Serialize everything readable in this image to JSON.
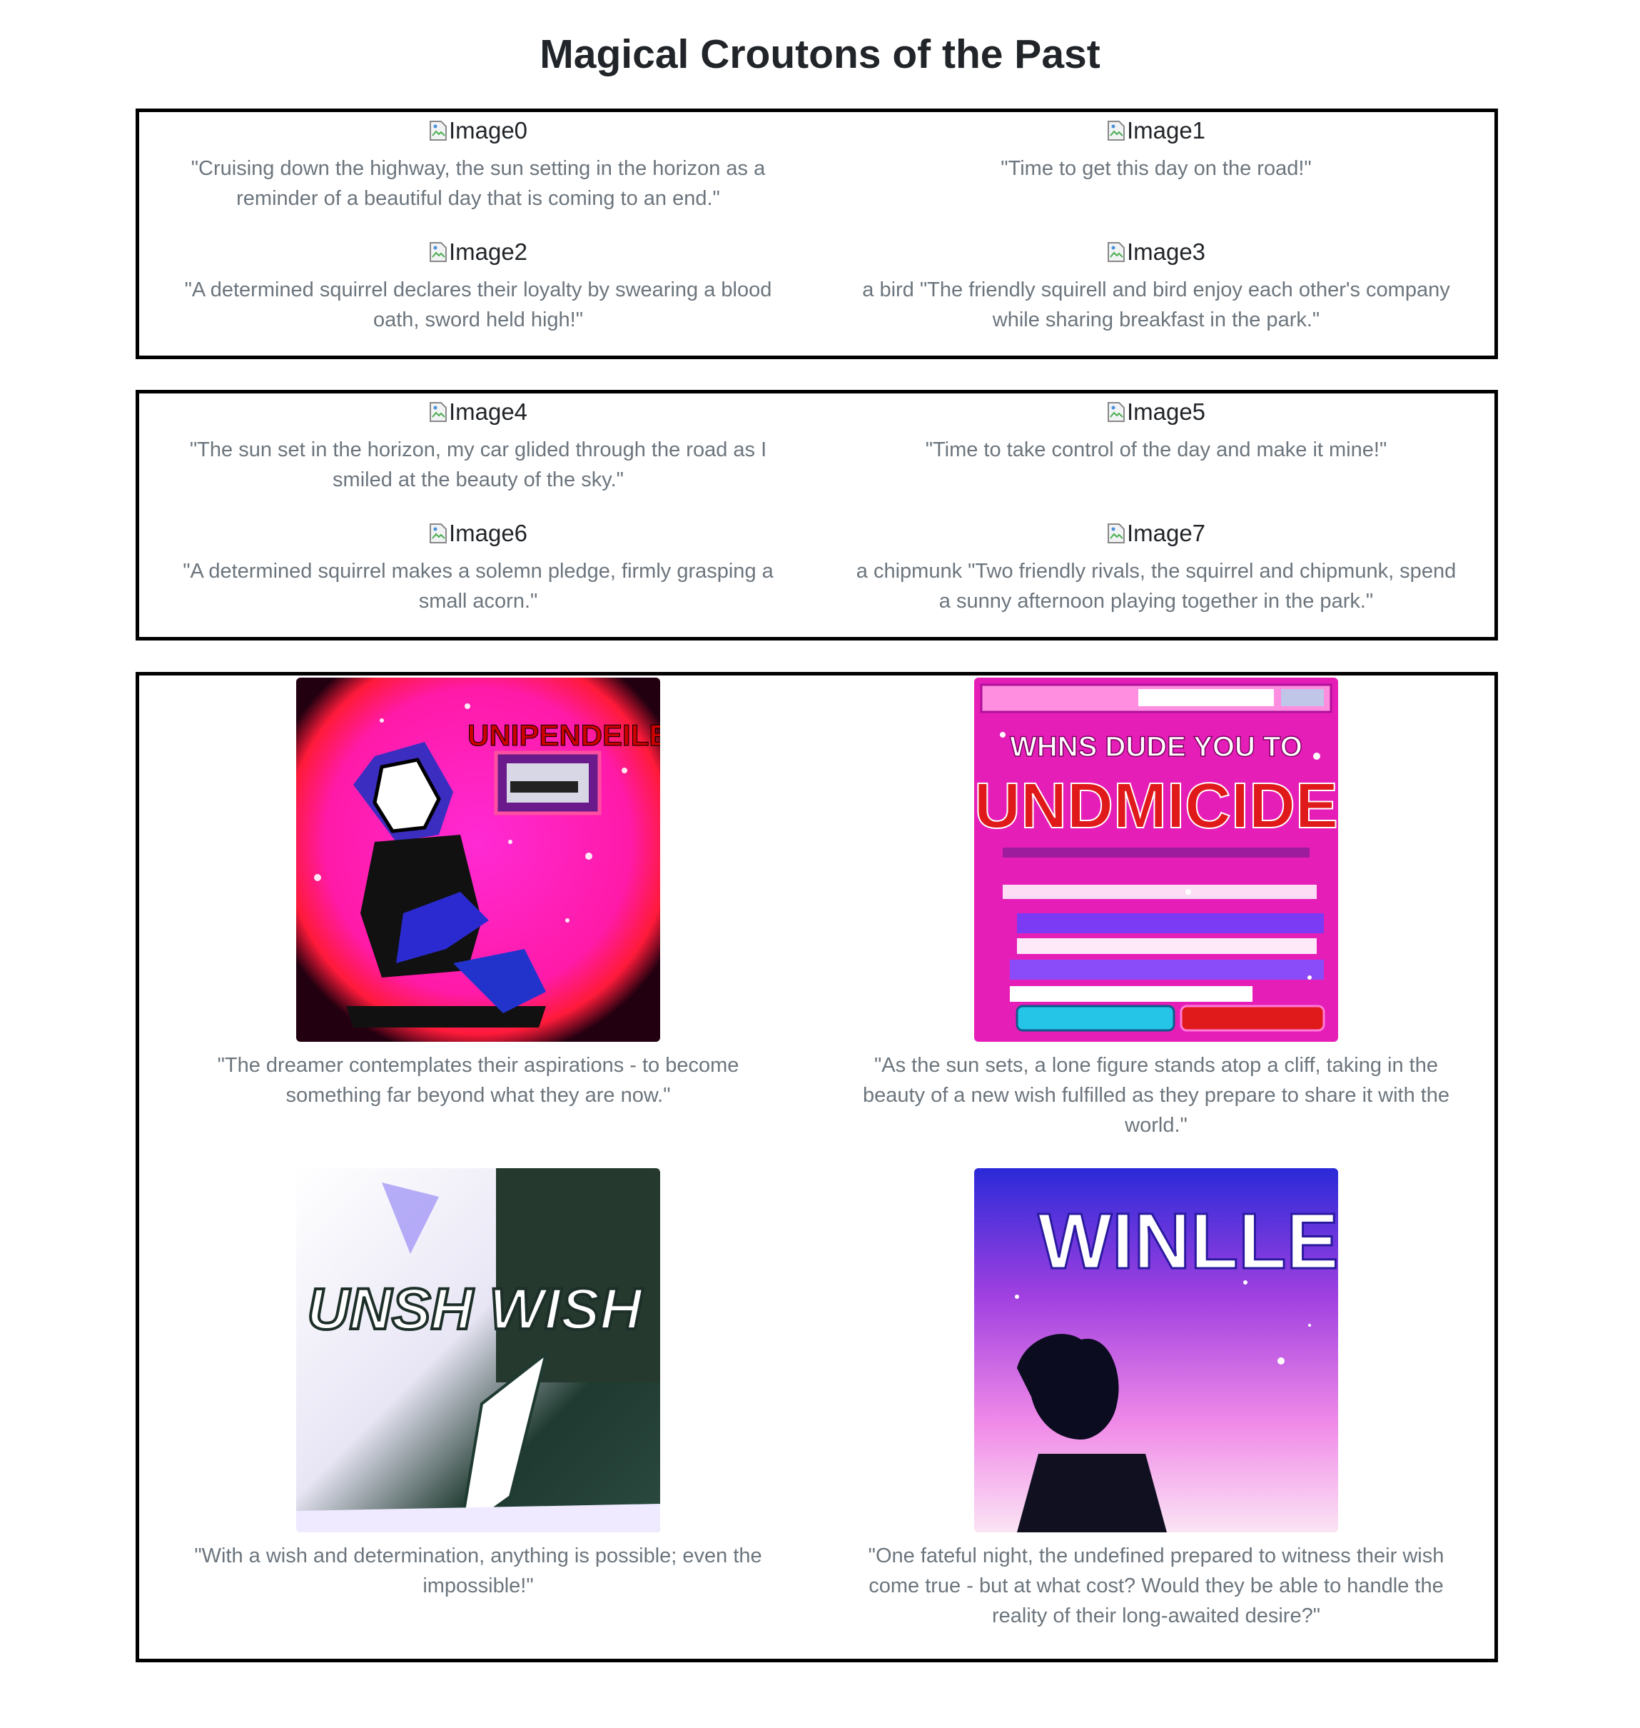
{
  "page": {
    "title": "Magical Croutons of the Past"
  },
  "panels": [
    {
      "items": [
        {
          "alt": "Image0",
          "caption": "\"Cruising down the highway, the sun setting in the horizon as a reminder of a beautiful day that is coming to an end.\""
        },
        {
          "alt": "Image1",
          "caption": "\"Time to get this day on the road!\""
        },
        {
          "alt": "Image2",
          "caption": "\"A determined squirrel declares their loyalty by swearing a blood oath, sword held high!\""
        },
        {
          "alt": "Image3",
          "caption": "a bird \"The friendly squirell and bird enjoy each other's company while sharing breakfast in the park.\""
        }
      ]
    },
    {
      "items": [
        {
          "alt": "Image4",
          "caption": "\"The sun set in the horizon, my car glided through the road as I smiled at the beauty of the sky.\""
        },
        {
          "alt": "Image5",
          "caption": "\"Time to take control of the day and make it mine!\""
        },
        {
          "alt": "Image6",
          "caption": "\"A determined squirrel makes a solemn pledge, firmly grasping a small acorn.\""
        },
        {
          "alt": "Image7",
          "caption": "a chipmunk \"Two friendly rivals, the squirrel and chipmunk, spend a sunny afternoon playing together in the park.\""
        }
      ]
    },
    {
      "items": [
        {
          "image_text": "UNIPENDEILE",
          "caption": "\"The dreamer contemplates their aspirations - to become something far beyond what they are now.\""
        },
        {
          "image_text": [
            "WHNS DUDE YOU TO",
            "UNDMICIDE"
          ],
          "caption": "\"As the sun sets, a lone figure stands atop a cliff, taking in the beauty of a new wish fulfilled as they prepare to share it with the world.\""
        },
        {
          "image_text": "UNSH WISH",
          "caption": "\"With a wish and determination, anything is possible; even the impossible!\""
        },
        {
          "image_text": "WINLLE",
          "caption": "\"One fateful night, the undefined prepared to witness their wish come true - but at what cost? Would they be able to handle the reality of their long-awaited desire?\""
        }
      ]
    }
  ],
  "colors": {
    "caption": "#6c757d",
    "border": "#000000",
    "heading": "#212529"
  }
}
